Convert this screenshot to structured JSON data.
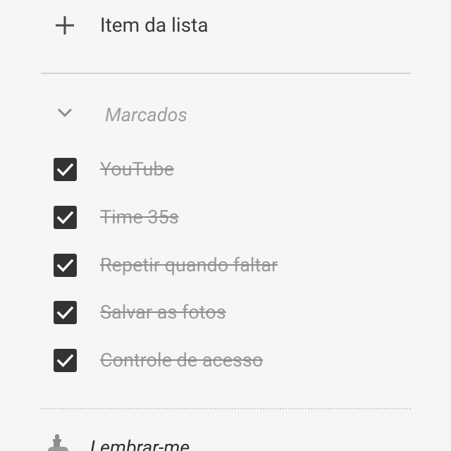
{
  "add_item": {
    "icon": "plus-icon",
    "label": "Item da lista"
  },
  "checked_section": {
    "icon": "chevron-down-icon",
    "label": "Marcados",
    "items": [
      {
        "text": "YouTube",
        "checked": true
      },
      {
        "text": "Time 35s",
        "checked": true
      },
      {
        "text": "Repetir quando faltar",
        "checked": true
      },
      {
        "text": "Salvar as fotos",
        "checked": true
      },
      {
        "text": "Controle de acesso",
        "checked": true
      }
    ]
  },
  "reminder": {
    "icon": "reminder-hand-icon",
    "label": "Lembrar-me"
  },
  "colors": {
    "background": "#f6f6f6",
    "checkbox_fill": "#333333",
    "checked_text": "#9a9a9a",
    "primary_text": "#3a3a3a"
  }
}
